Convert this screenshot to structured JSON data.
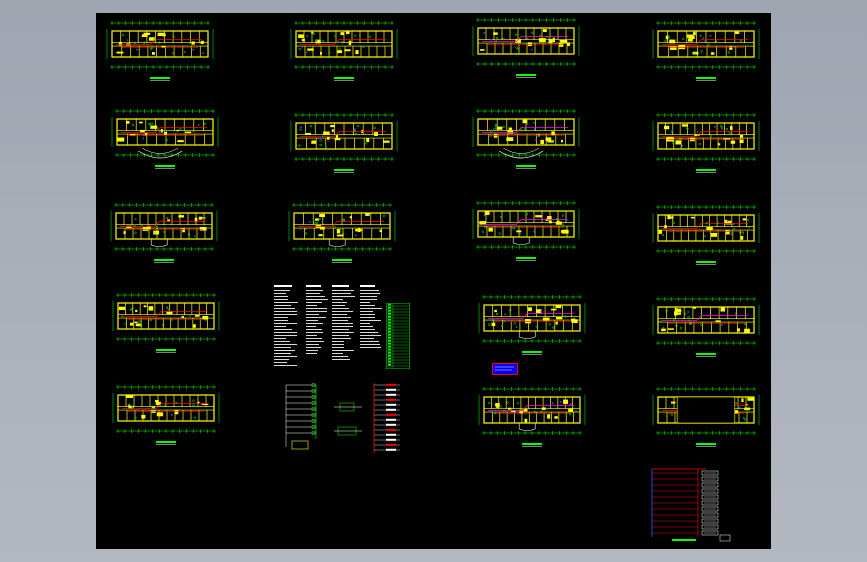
{
  "viewer": {
    "background_color": "#a6acb6",
    "canvas_color": "#000000"
  },
  "drawing": {
    "sheet_type": "floor-plan-electrical",
    "colors": {
      "wall": "#ffff00",
      "grid": "#00ff00",
      "wire_red": "#ff0000",
      "wire_magenta": "#ff00ff",
      "symbol_blue": "#3060ff",
      "text_white": "#ffffff"
    },
    "legend_box_label": "",
    "sheets": [
      {
        "id": "plan-1-1",
        "variant": "a"
      },
      {
        "id": "plan-1-2",
        "variant": "b"
      },
      {
        "id": "plan-1-3",
        "variant": "c"
      },
      {
        "id": "plan-1-4",
        "variant": "d"
      },
      {
        "id": "plan-2-1",
        "variant": "a"
      },
      {
        "id": "plan-2-2",
        "variant": "b"
      },
      {
        "id": "plan-2-3",
        "variant": "c"
      },
      {
        "id": "plan-2-4",
        "variant": "d"
      },
      {
        "id": "plan-3-1",
        "variant": "a"
      },
      {
        "id": "plan-3-2",
        "variant": "b"
      },
      {
        "id": "plan-3-3",
        "variant": "c"
      },
      {
        "id": "plan-3-4",
        "variant": "d"
      },
      {
        "id": "plan-4-1",
        "variant": "a"
      },
      {
        "id": "plan-4-3",
        "variant": "c"
      },
      {
        "id": "plan-4-4",
        "variant": "d"
      },
      {
        "id": "plan-5-1",
        "variant": "a"
      },
      {
        "id": "plan-5-3",
        "variant": "c"
      },
      {
        "id": "plan-5-4",
        "variant": "e"
      }
    ]
  }
}
